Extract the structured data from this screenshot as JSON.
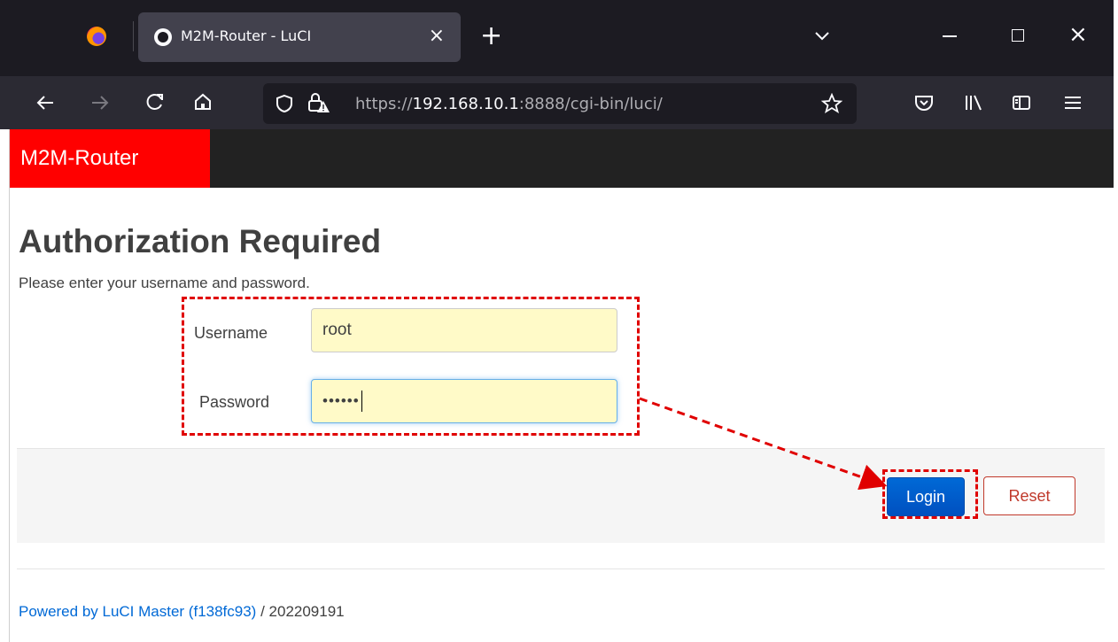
{
  "browser": {
    "tab_title": "M2M-Router - LuCI",
    "tab_close": "×",
    "new_tab": "+",
    "win_close": "×",
    "url_scheme": "https://",
    "url_host": "192.168.10.1",
    "url_rest": ":8888/cgi-bin/luci/",
    "nav_icons": [
      "back-arrow-icon",
      "forward-arrow-icon",
      "reload-icon",
      "home-icon",
      "shield-icon",
      "lock-warning-icon",
      "bookmark-star-icon",
      "pocket-icon",
      "library-icon",
      "sidebar-icon",
      "menu-icon"
    ]
  },
  "header": {
    "brand": "M2M-Router",
    "brand_color": "#ff0000",
    "bar_color": "#222222"
  },
  "auth": {
    "title": "Authorization Required",
    "description": "Please enter your username and password.",
    "username_label": "Username",
    "username_value": "root",
    "password_label": "Password",
    "password_mask": "••••••"
  },
  "actions": {
    "login_label": "Login",
    "reset_label": "Reset"
  },
  "footer": {
    "powered_link": "Powered by LuCI Master (f138fc93)",
    "version": " / 202209191"
  },
  "annotation_color": "#e00000"
}
